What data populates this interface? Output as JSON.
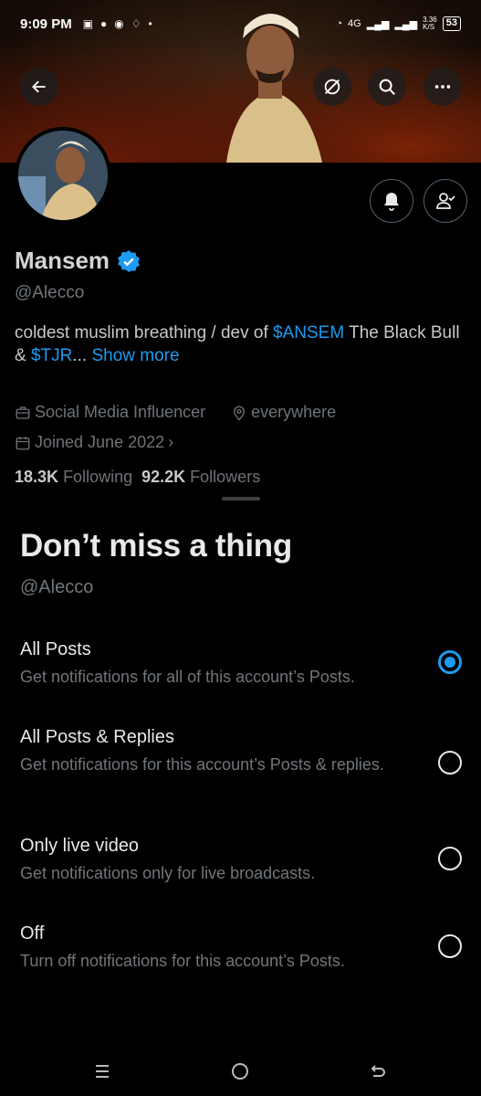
{
  "status_bar": {
    "time": "9:09 PM",
    "network": "4G",
    "speed": "3.36\nK/S",
    "battery": "53"
  },
  "profile": {
    "name": "Mansem",
    "handle": "@Alecco",
    "bio_text_1": "coldest muslim breathing / dev of ",
    "bio_link_1": "$ANSEM",
    "bio_text_2": " The Black Bull & ",
    "bio_link_2": "$TJR",
    "bio_ellipsis": "...",
    "bio_show_more": " Show more",
    "category": "Social Media Influencer",
    "location": "everywhere",
    "joined": "Joined June 2022",
    "following_count": "18.3K",
    "following_label": "Following",
    "followers_count": "92.2K",
    "followers_label": "Followers"
  },
  "sheet": {
    "title": "Don’t miss a thing",
    "handle": "@Alecco",
    "options": [
      {
        "title": "All Posts",
        "desc": "Get notifications for all of this account’s Posts.",
        "selected": true
      },
      {
        "title": "All Posts & Replies",
        "desc": "Get notifications for this account’s Posts & replies.",
        "selected": false
      },
      {
        "title": "Only live video",
        "desc": "Get notifications only for live broadcasts.",
        "selected": false
      },
      {
        "title": "Off",
        "desc": "Turn off notifications for this account’s Posts.",
        "selected": false
      }
    ]
  },
  "colors": {
    "accent": "#1d9bf0",
    "background": "#000000",
    "muted_text": "#71767b"
  }
}
